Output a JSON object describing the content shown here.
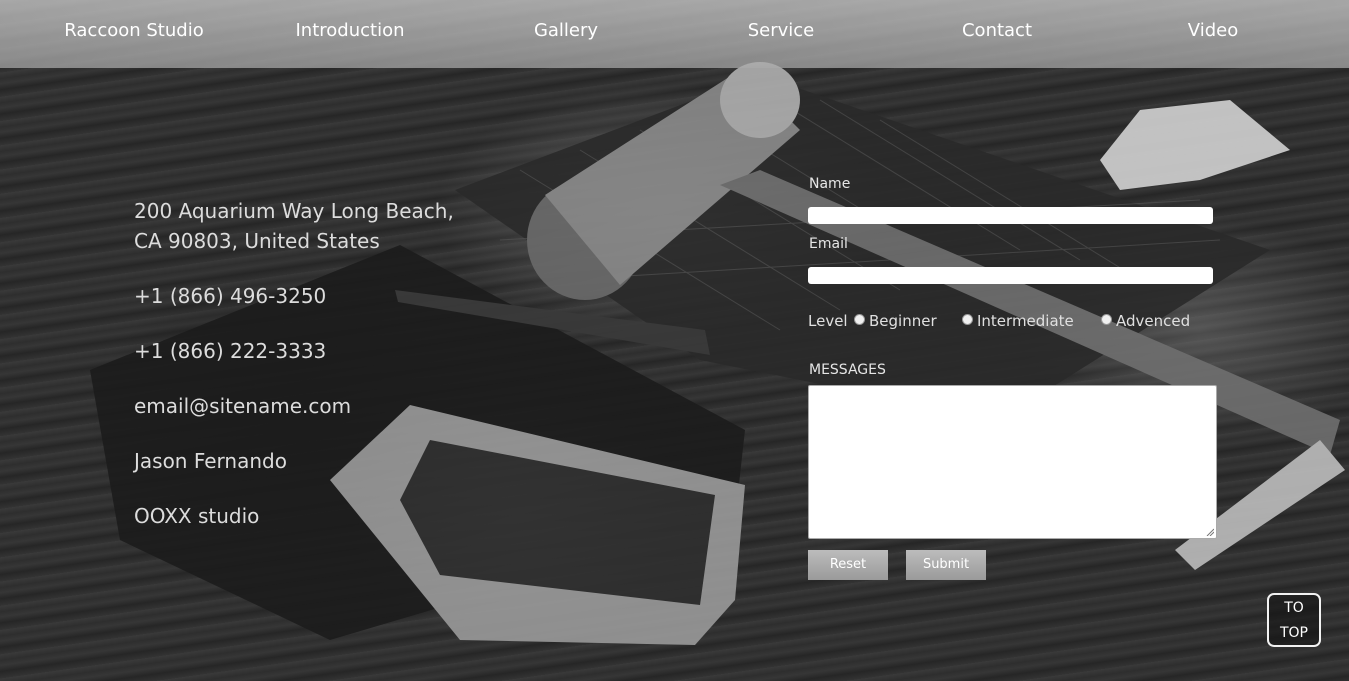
{
  "nav": {
    "items": [
      {
        "label": "Raccoon Studio"
      },
      {
        "label": "Introduction"
      },
      {
        "label": "Gallery"
      },
      {
        "label": "Service"
      },
      {
        "label": "Contact"
      },
      {
        "label": "Video"
      }
    ]
  },
  "contact": {
    "address_line1": "200 Aquarium Way Long Beach,",
    "address_line2": "CA 90803, United States",
    "phone1": "+1 (866) 496-3250",
    "phone2": "+1 (866) 222-3333",
    "email": "email@sitename.com",
    "name": "Jason Fernando",
    "company": "OOXX studio"
  },
  "form": {
    "name_label": "Name",
    "name_value": "",
    "email_label": "Email",
    "email_value": "",
    "level_label": "Level",
    "level_options": [
      {
        "label": "Beginner",
        "selected": false
      },
      {
        "label": "Intermediate",
        "selected": false
      },
      {
        "label": "Advenced",
        "selected": false
      }
    ],
    "messages_label": "MESSAGES",
    "messages_value": "",
    "reset_label": "Reset",
    "submit_label": "Submit"
  },
  "to_top": {
    "line1": "TO",
    "line2": "TOP"
  }
}
